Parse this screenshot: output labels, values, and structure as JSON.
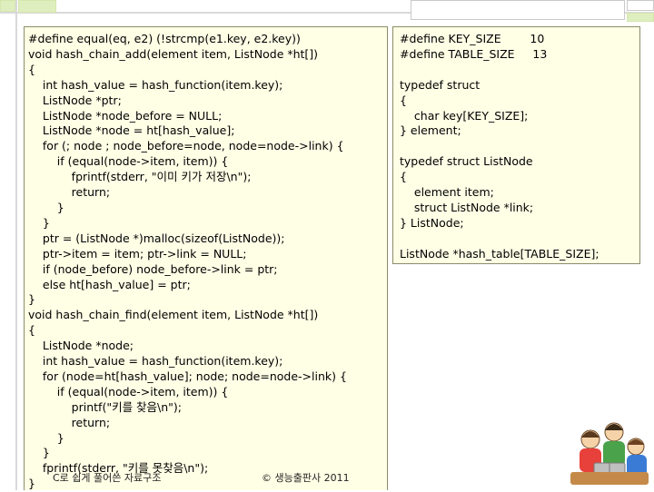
{
  "slide": {
    "code_main_lines": [
      "#define equal(eq, e2) (!strcmp(e1.key, e2.key))",
      "void hash_chain_add(element item, ListNode *ht[])",
      "{",
      "    int hash_value = hash_function(item.key);",
      "    ListNode *ptr;",
      "    ListNode *node_before = NULL;",
      "    ListNode *node = ht[hash_value];",
      "    for (; node ; node_before=node, node=node->link) {",
      "        if (equal(node->item, item)) {",
      "            fprintf(stderr, \"이미 키가 저장\\n\");",
      "            return;",
      "        }",
      "    }",
      "    ptr = (ListNode *)malloc(sizeof(ListNode));",
      "    ptr->item = item; ptr->link = NULL;",
      "    if (node_before) node_before->link = ptr;",
      "    else ht[hash_value] = ptr;",
      "}",
      "void hash_chain_find(element item, ListNode *ht[])",
      "{",
      "    ListNode *node;",
      "    int hash_value = hash_function(item.key);",
      "    for (node=ht[hash_value]; node; node=node->link) {",
      "        if (equal(node->item, item)) {",
      "            printf(\"키를 찾음\\n\");",
      "            return;",
      "        }",
      "    }",
      "    fprintf(stderr, \"키를 못찾음\\n\");",
      "}"
    ],
    "code_defs_lines": [
      "#define KEY_SIZE        10",
      "#define TABLE_SIZE     13",
      "",
      "typedef struct",
      "{",
      "    char key[KEY_SIZE];",
      "} element;",
      "",
      "typedef struct ListNode",
      "{",
      "    element item;",
      "    struct ListNode *link;",
      "} ListNode;",
      "",
      "ListNode *hash_table[TABLE_SIZE];"
    ],
    "footer_left": "C로 쉽게 풀어쓴 자료구조",
    "footer_right": "© 생능출판사 2011",
    "colors": {
      "panel_bg": "#ffffe6",
      "accent_green": "#dfeebe"
    }
  }
}
